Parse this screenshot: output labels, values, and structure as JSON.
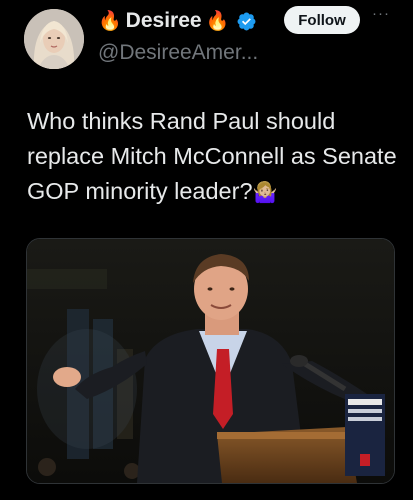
{
  "author": {
    "display_name": "Desiree",
    "name_prefix_emoji": "🔥",
    "name_suffix_emoji": "🔥",
    "handle": "@DesireeAmer...",
    "verified": true,
    "verified_color": "#1d9bf0"
  },
  "actions": {
    "follow_label": "Follow",
    "more_label": "···"
  },
  "tweet": {
    "text": "Who thinks Rand Paul should replace Mitch McConnell as Senate GOP minority leader?",
    "emoji": "🤷🏼‍♀️"
  },
  "media": {
    "type": "photo"
  },
  "colors": {
    "background": "#000000",
    "text": "#e7e9ea",
    "secondary_text": "#71767b",
    "follow_bg": "#eff3f4"
  }
}
